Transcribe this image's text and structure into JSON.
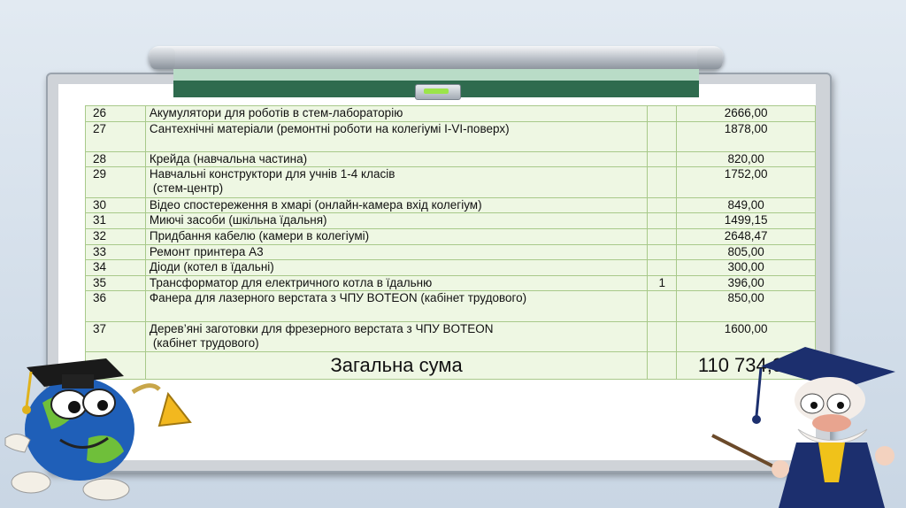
{
  "table": {
    "rows": [
      {
        "num": "26",
        "desc": "Акумулятори для роботів  в  стем-лабораторію",
        "desc2": "",
        "qty": "",
        "amount": "2666,00"
      },
      {
        "num": "27",
        "desc": "Сантехнічні матеріали (ремонтні роботи на колегіумі I-VI-поверх)",
        "desc2": "",
        "qty": "",
        "amount": "1878,00"
      },
      {
        "num": "28",
        "desc": "Крейда (навчальна частина)",
        "desc2": "",
        "qty": "",
        "amount": "820,00"
      },
      {
        "num": "29",
        "desc": "Навчальні конструктори для учнів 1-4 класів",
        "desc2": "(стем-центр)",
        "qty": "",
        "amount": "1752,00"
      },
      {
        "num": "30",
        "desc": "Відео спостереження в хмарі (онлайн-камера  вхід колегіум)",
        "desc2": "",
        "qty": "",
        "amount": "849,00"
      },
      {
        "num": "31",
        "desc": "Миючі засоби (шкільна їдальня)",
        "desc2": "",
        "qty": "",
        "amount": "1499,15"
      },
      {
        "num": "32",
        "desc": "Придбання кабелю (камери в колегіумі)",
        "desc2": "",
        "qty": "",
        "amount": "2648,47"
      },
      {
        "num": "33",
        "desc": "Ремонт принтера А3",
        "desc2": "",
        "qty": "",
        "amount": "805,00"
      },
      {
        "num": "34",
        "desc": "Діоди (котел в їдальні)",
        "desc2": "",
        "qty": "",
        "amount": "300,00"
      },
      {
        "num": "35",
        "desc": "Трансформатор для електричного котла в їдальню",
        "desc2": "",
        "qty": "1",
        "amount": "396,00"
      },
      {
        "num": "36",
        "desc": "Фанера для лазерного верстата з ЧПУ BOTEON (кабінет трудового)",
        "desc2": "",
        "qty": "",
        "amount": "850,00"
      },
      {
        "num": "37",
        "desc": "Дерев’яні заготовки для фрезерного верстата з ЧПУ BOTEON",
        "desc2": "(кабінет трудового)",
        "qty": "",
        "amount": "1600,00"
      }
    ],
    "total_label": "Загальна сума",
    "total_amount": "110 734,94"
  },
  "colors": {
    "table_bg": "#eef7e3",
    "grid": "#a8c98a",
    "board_green": "#2f6b4e"
  },
  "decorations": {
    "left_character": "globe-graduate-with-bell",
    "right_character": "professor-with-pointer"
  }
}
